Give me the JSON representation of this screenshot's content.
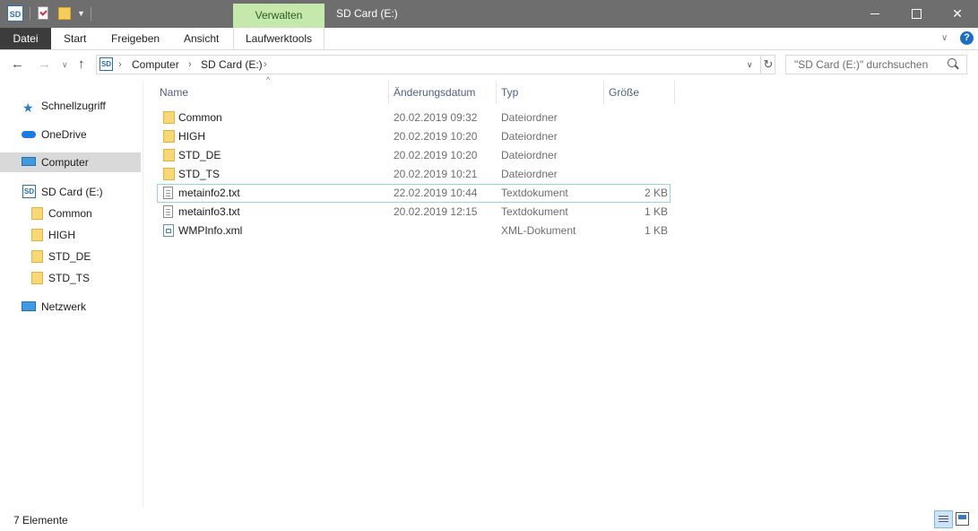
{
  "window": {
    "title": "SD Card (E:)",
    "context_tab": "Verwalten",
    "qat_icon_text": "SD"
  },
  "ribbon": {
    "tabs": [
      "Datei",
      "Start",
      "Freigeben",
      "Ansicht",
      "Laufwerktools"
    ]
  },
  "address": {
    "crumbs": [
      "Computer",
      "SD Card (E:)"
    ],
    "search_placeholder": "\"SD Card (E:)\" durchsuchen"
  },
  "sidebar": {
    "items": [
      {
        "label": "Schnellzugriff",
        "icon": "star-icon"
      },
      {
        "label": "OneDrive",
        "icon": "cloud-icon"
      },
      {
        "label": "Computer",
        "icon": "computer-icon",
        "selected": true
      },
      {
        "label": "SD Card (E:)",
        "icon": "sd-card-icon"
      },
      {
        "label": "Common",
        "icon": "folder-icon"
      },
      {
        "label": "HIGH",
        "icon": "folder-icon"
      },
      {
        "label": "STD_DE",
        "icon": "folder-icon"
      },
      {
        "label": "STD_TS",
        "icon": "folder-icon"
      },
      {
        "label": "Netzwerk",
        "icon": "network-icon"
      }
    ]
  },
  "columns": [
    "Name",
    "Änderungsdatum",
    "Typ",
    "Größe"
  ],
  "files": [
    {
      "name": "Common",
      "date": "20.02.2019 09:32",
      "type": "Dateiordner",
      "size": "",
      "icon": "folder-icon"
    },
    {
      "name": "HIGH",
      "date": "20.02.2019 10:20",
      "type": "Dateiordner",
      "size": "",
      "icon": "folder-icon"
    },
    {
      "name": "STD_DE",
      "date": "20.02.2019 10:20",
      "type": "Dateiordner",
      "size": "",
      "icon": "folder-icon"
    },
    {
      "name": "STD_TS",
      "date": "20.02.2019 10:21",
      "type": "Dateiordner",
      "size": "",
      "icon": "folder-icon"
    },
    {
      "name": "metainfo2.txt",
      "date": "22.02.2019 10:44",
      "type": "Textdokument",
      "size": "2 KB",
      "icon": "text-file-icon",
      "focused": true
    },
    {
      "name": "metainfo3.txt",
      "date": "20.02.2019 12:15",
      "type": "Textdokument",
      "size": "1 KB",
      "icon": "text-file-icon"
    },
    {
      "name": "WMPInfo.xml",
      "date": "",
      "type": "XML-Dokument",
      "size": "1 KB",
      "icon": "xml-file-icon"
    }
  ],
  "status": {
    "count": "7 Elemente"
  }
}
